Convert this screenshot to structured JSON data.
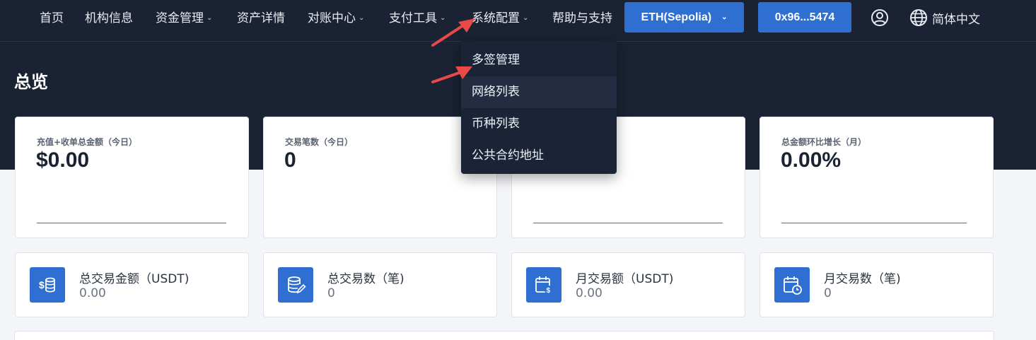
{
  "nav": {
    "items": [
      {
        "label": "首页",
        "has_dropdown": false
      },
      {
        "label": "机构信息",
        "has_dropdown": false
      },
      {
        "label": "资金管理",
        "has_dropdown": true
      },
      {
        "label": "资产详情",
        "has_dropdown": false
      },
      {
        "label": "对账中心",
        "has_dropdown": true
      },
      {
        "label": "支付工具",
        "has_dropdown": true
      },
      {
        "label": "系统配置",
        "has_dropdown": true
      },
      {
        "label": "帮助与支持",
        "has_dropdown": false
      }
    ],
    "network_button": "ETH(Sepolia)",
    "wallet_button": "0x96...5474",
    "language": "简体中文"
  },
  "page": {
    "title": "总览"
  },
  "stat_cards": [
    {
      "label": "充值+收单总金额（今日）",
      "value": "$0.00"
    },
    {
      "label": "交易笔数（今日）",
      "value": "0"
    },
    {
      "label": "",
      "value": ""
    },
    {
      "label": "总金额环比增长（月）",
      "value": "0.00%"
    }
  ],
  "summary_cards": [
    {
      "title": "总交易金额（USDT)",
      "value": "0.00",
      "icon": "dollar-coins-icon"
    },
    {
      "title": "总交易数（笔)",
      "value": "0",
      "icon": "database-edit-icon"
    },
    {
      "title": "月交易额（USDT)",
      "value": "0.00",
      "icon": "calendar-dollar-icon"
    },
    {
      "title": "月交易数（笔)",
      "value": "0",
      "icon": "calendar-clock-icon"
    }
  ],
  "dropdown": {
    "parent": "系统配置",
    "items": [
      "多签管理",
      "网络列表",
      "币种列表",
      "公共合约地址"
    ],
    "hovered_index": 1
  },
  "colors": {
    "header_bg": "#1a2233",
    "accent": "#2f6fd1",
    "annotation_arrow": "#e84a4a"
  }
}
